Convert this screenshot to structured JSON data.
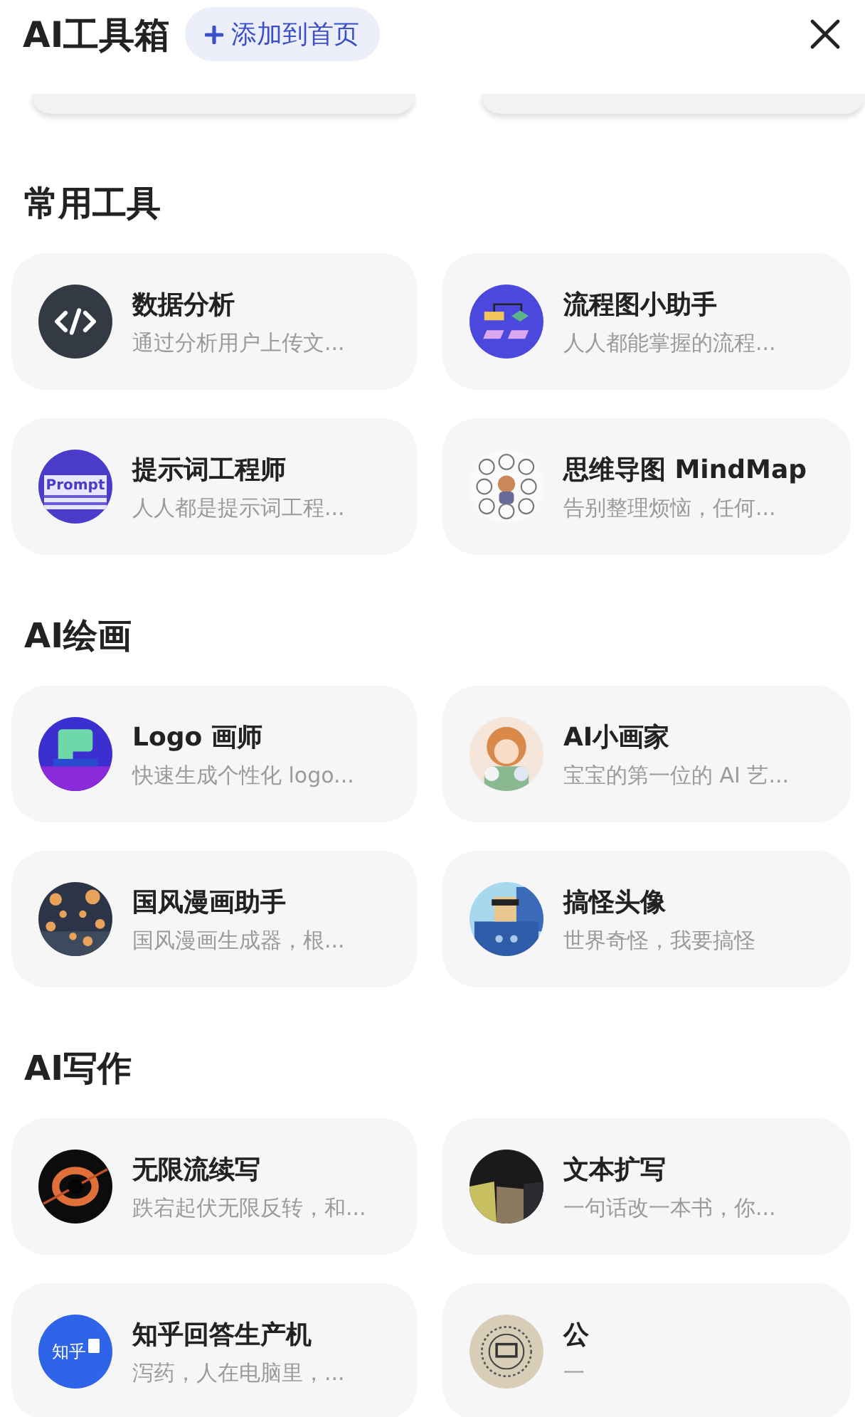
{
  "header": {
    "title": "AI工具箱",
    "add_button": "添加到首页"
  },
  "sections": [
    {
      "title": "常用工具",
      "tools": [
        {
          "name": "数据分析",
          "desc": "通过分析用户上传文...",
          "icon": {
            "kind": "code"
          }
        },
        {
          "name": "流程图小助手",
          "desc": "人人都能掌握的流程...",
          "icon": {
            "kind": "flowchart"
          }
        },
        {
          "name": "提示词工程师",
          "desc": "人人都是提示词工程...",
          "icon": {
            "kind": "prompt",
            "text": "Prompt"
          }
        },
        {
          "name": "思维导图 MindMap",
          "desc": "告别整理烦恼，任何..."
        }
      ]
    },
    {
      "title": "AI绘画",
      "tools": [
        {
          "name": "Logo 画师",
          "desc": "快速生成个性化 logo..."
        },
        {
          "name": "AI小画家",
          "desc": "宝宝的第一位的 AI 艺..."
        },
        {
          "name": "国风漫画助手",
          "desc": "国风漫画生成器，根..."
        },
        {
          "name": "搞怪头像",
          "desc": "世界奇怪，我要搞怪"
        }
      ]
    },
    {
      "title": "AI写作",
      "tools": [
        {
          "name": "无限流续写",
          "desc": "跌宕起伏无限反转，和..."
        },
        {
          "name": "文本扩写",
          "desc": "一句话改一本书，你..."
        },
        {
          "name": "知乎回答生产机",
          "desc": "泻药，人在电脑里，...",
          "icon": {
            "kind": "badge",
            "text": "知乎"
          }
        },
        {
          "name": "公",
          "desc": "一"
        }
      ]
    }
  ]
}
